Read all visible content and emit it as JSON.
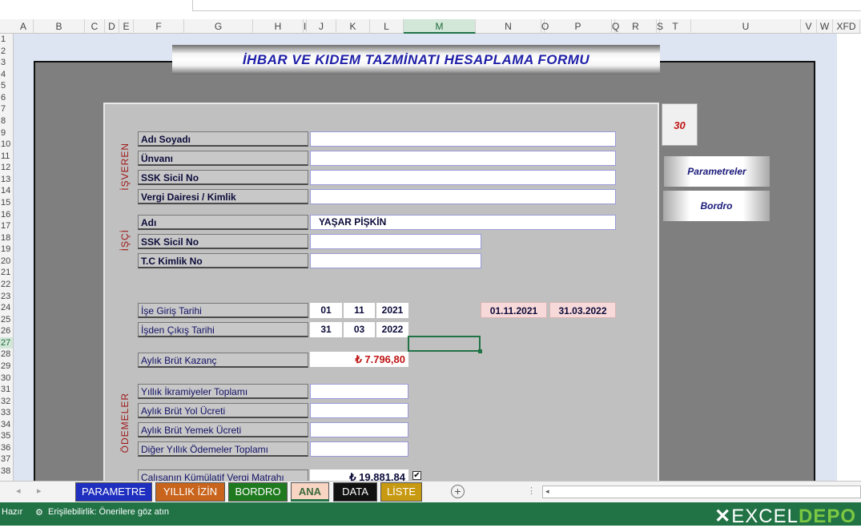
{
  "columns": [
    "A",
    "B",
    "C",
    "D",
    "E",
    "F",
    "G",
    "H",
    "I",
    "J",
    "K",
    "L",
    "M",
    "N",
    "O",
    "P",
    "Q",
    "R",
    "S",
    "T",
    "U",
    "V",
    "W",
    "XFD"
  ],
  "rows": [
    "1",
    "2",
    "3",
    "4",
    "5",
    "6",
    "7",
    "8",
    "9",
    "10",
    "11",
    "12",
    "13",
    "14",
    "15",
    "16",
    "17",
    "18",
    "19",
    "20",
    "21",
    "22",
    "23",
    "24",
    "25",
    "26",
    "27",
    "28",
    "29",
    "30",
    "31",
    "32",
    "33",
    "34",
    "35",
    "36",
    "37",
    "38"
  ],
  "form": {
    "title": "İHBAR VE KIDEM TAZMİNATI HESAPLAMA FORMU",
    "badge": "30",
    "sections": {
      "isveren": "İŞVEREN",
      "isci": "İŞÇİ",
      "odemeler": "ÖDEMELER"
    },
    "employer": {
      "name_label": "Adı Soyadı",
      "title_label": "Ünvanı",
      "ssk_label": "SSK Sicil No",
      "tax_label": "Vergi Dairesi / Kimlik"
    },
    "worker": {
      "name_label": "Adı",
      "name_value": "YAŞAR PİŞKİN",
      "ssk_label": "SSK Sicil No",
      "tc_label": "T.C Kimlik No"
    },
    "dates": {
      "start_label": "İşe Giriş Tarihi",
      "start_day": "01",
      "start_month": "11",
      "start_year": "2021",
      "end_label": "İşden Çıkış Tarihi",
      "end_day": "31",
      "end_month": "03",
      "end_year": "2022",
      "start_full": "01.11.2021",
      "end_full": "31.03.2022"
    },
    "salary": {
      "label": "Aylık Brüt Kazanç",
      "value": "₺ 7.796,80"
    },
    "payments": {
      "bonus_label": "Yıllık İkramiyeler Toplamı",
      "travel_label": "Aylık Brüt Yol Ücreti",
      "meal_label": "Aylık Brüt Yemek Ücreti",
      "other_label": "Diğer Yıllık Ödemeler Toplamı"
    },
    "tax_base": {
      "label": "Çalışanın Kümülatif Vergi Matrahı",
      "value": "₺ 19.881,84",
      "checkbox": "✔"
    }
  },
  "side_buttons": {
    "parametreler": "Parametreler",
    "bordro": "Bordro"
  },
  "tabs": [
    {
      "label": "PARAMETRE",
      "bg": "#1f2fbf",
      "fg": "#ffffff"
    },
    {
      "label": "YILLIK İZİN",
      "bg": "#c8641c",
      "fg": "#ffffff"
    },
    {
      "label": "BORDRO",
      "bg": "#1f7a1f",
      "fg": "#ffffff"
    },
    {
      "label": "ANA",
      "bg": "#f8d4c3",
      "fg": "#3c6b3c"
    },
    {
      "label": "DATA",
      "bg": "#111111",
      "fg": "#ffffff"
    },
    {
      "label": "LİSTE",
      "bg": "#c79a12",
      "fg": "#ffffff"
    }
  ],
  "status": {
    "ready": "Hazır",
    "accessibility": "Erişilebilirlik: Önerilere göz atın",
    "logo_a": "EXCEL",
    "logo_b": "DEPO"
  },
  "colors": {
    "excel_green": "#217346",
    "title_blue": "#1f1fa8",
    "section_red": "#a01a1a",
    "salary_red": "#c01515"
  }
}
